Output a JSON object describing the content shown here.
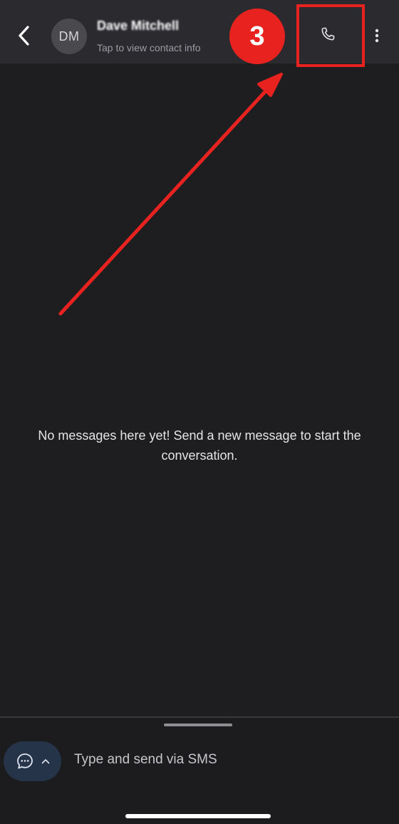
{
  "header": {
    "back_icon": "chevron-left-icon",
    "avatar_initials": "DM",
    "contact_name": "Dave Mitchell",
    "contact_subtitle": "Tap to view contact info",
    "call_icon": "phone-icon",
    "more_icon": "more-vertical-icon"
  },
  "annotation": {
    "step_number": "3",
    "color": "#e8231f"
  },
  "conversation": {
    "empty_message": "No messages here yet! Send a new message to start the conversation."
  },
  "composer": {
    "toggle_icon": "chat-bubble-icon",
    "toggle_chevron": "chevron-up-icon",
    "placeholder": "Type and send via SMS",
    "value": ""
  },
  "colors": {
    "background": "#1e1e21",
    "header_background": "#2b2b2f",
    "toggle_background": "#253449"
  }
}
